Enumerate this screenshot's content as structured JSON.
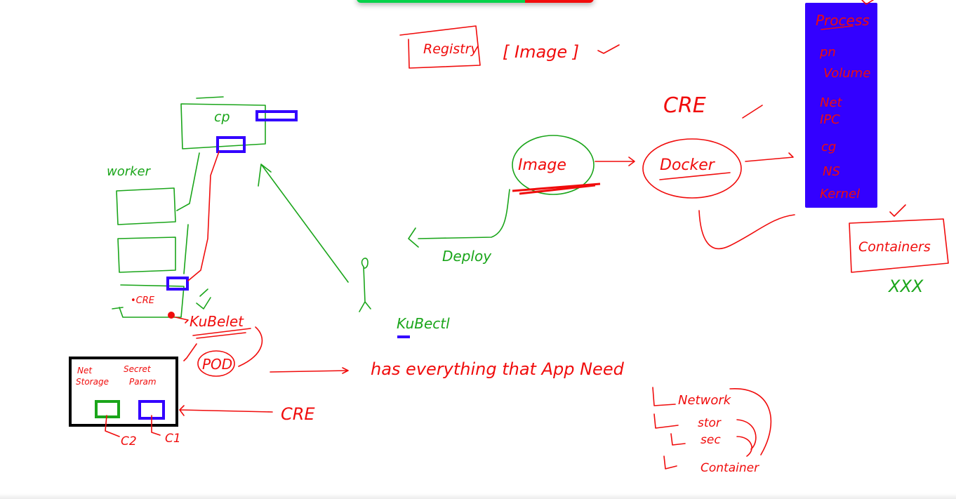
{
  "toolbar": {
    "colors": [
      "#06d24a",
      "#f20c0c"
    ]
  },
  "colors": {
    "red": "#f00c0c",
    "green": "#1aa51a",
    "blue": "#3300ff",
    "black": "#000000"
  },
  "top": {
    "registry": "Registry",
    "image_bracket": "[ Image ]"
  },
  "cre_label": "CRE",
  "process_panel": {
    "title": "Process",
    "items": [
      "pn",
      "Volume",
      "Net",
      "IPC",
      "cg",
      "NS",
      "Kernel"
    ]
  },
  "containers": {
    "label": "Containers",
    "marks": "XXX"
  },
  "cluster": {
    "cp": "cp",
    "worker": "worker",
    "node_cre": "•CRE",
    "kubelet": "KuBelet",
    "kubectl": "KuBectl",
    "deploy": "Deploy"
  },
  "flow": {
    "image": "Image",
    "docker": "Docker"
  },
  "pod": {
    "label": "POD",
    "net_storage": [
      "Net",
      "Storage"
    ],
    "secret_param": [
      "Secret",
      "Param"
    ],
    "c2": "C2",
    "c1": "C1",
    "cre": "CRE"
  },
  "needs": {
    "sentence": "has   everything   that   App  Need",
    "items": [
      "Network",
      "stor",
      "sec",
      "Container"
    ]
  }
}
